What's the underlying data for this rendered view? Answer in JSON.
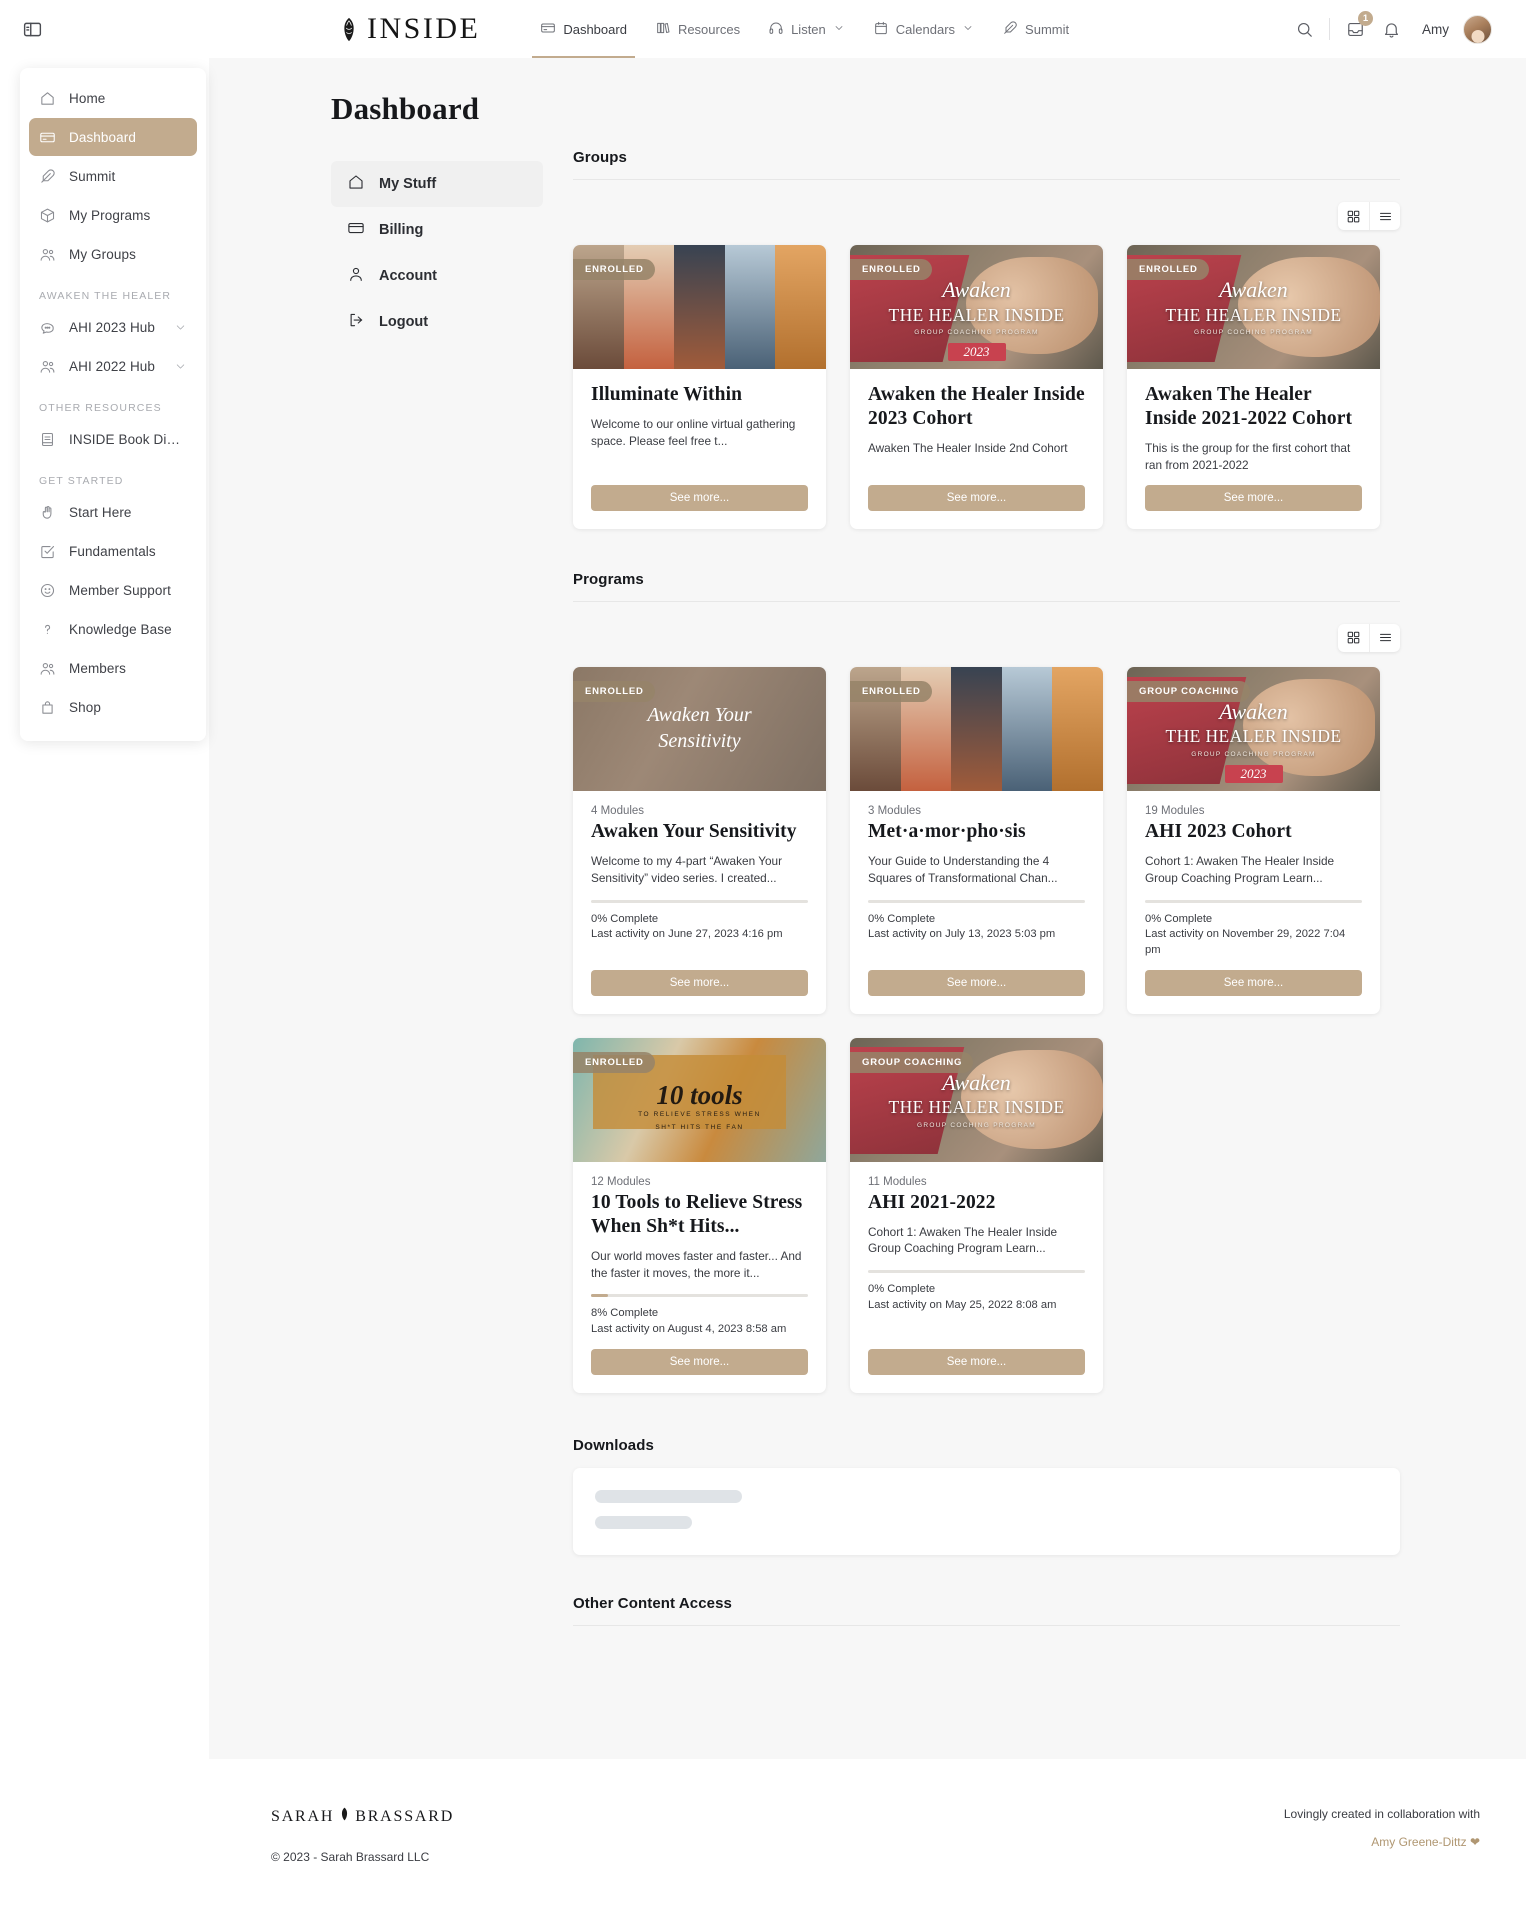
{
  "sidebar": {
    "toggle_icon": "panel-toggle-icon",
    "items": [
      {
        "label": "Home",
        "icon": "home-icon",
        "active": false
      },
      {
        "label": "Dashboard",
        "icon": "card-icon",
        "active": true
      },
      {
        "label": "Summit",
        "icon": "feather-icon",
        "active": false
      },
      {
        "label": "My Programs",
        "icon": "box-icon",
        "active": false
      },
      {
        "label": "My Groups",
        "icon": "users-icon",
        "active": false
      }
    ],
    "sections": [
      {
        "title": "AWAKEN THE HEALER",
        "items": [
          {
            "label": "AHI 2023 Hub",
            "icon": "chat-icon",
            "chevron": true
          },
          {
            "label": "AHI 2022 Hub",
            "icon": "users-icon",
            "chevron": true
          }
        ]
      },
      {
        "title": "OTHER RESOURCES",
        "items": [
          {
            "label": "INSIDE Book Digital ...",
            "icon": "book-icon",
            "chevron": false
          }
        ]
      },
      {
        "title": "GET STARTED",
        "items": [
          {
            "label": "Start Here",
            "icon": "wave-hand-icon",
            "chevron": false
          },
          {
            "label": "Fundamentals",
            "icon": "check-square-icon",
            "chevron": false
          },
          {
            "label": "Member Support",
            "icon": "smiley-icon",
            "chevron": false
          },
          {
            "label": "Knowledge Base",
            "icon": "question-icon",
            "chevron": false
          },
          {
            "label": "Members",
            "icon": "users-icon",
            "chevron": false
          },
          {
            "label": "Shop",
            "icon": "bag-icon",
            "chevron": false
          }
        ]
      }
    ]
  },
  "topbar": {
    "brand": "INSIDE",
    "brand_mark": "pinecone-icon",
    "nav": [
      {
        "label": "Dashboard",
        "icon": "card-icon",
        "chevron": false,
        "active": true
      },
      {
        "label": "Resources",
        "icon": "books-icon",
        "chevron": false,
        "active": false
      },
      {
        "label": "Listen",
        "icon": "headphones-icon",
        "chevron": true,
        "active": false
      },
      {
        "label": "Calendars",
        "icon": "calendar-icon",
        "chevron": true,
        "active": false
      },
      {
        "label": "Summit",
        "icon": "feather-icon",
        "chevron": false,
        "active": false
      }
    ],
    "search_icon": "search-icon",
    "inbox_icon": "inbox-icon",
    "inbox_count": "1",
    "bell_icon": "bell-icon",
    "user_name": "Amy",
    "avatar": "user-avatar"
  },
  "main": {
    "page_title": "Dashboard",
    "subnav": [
      {
        "label": "My Stuff",
        "icon": "home-icon",
        "active": true
      },
      {
        "label": "Billing",
        "icon": "card-icon",
        "active": false
      },
      {
        "label": "Account",
        "icon": "person-icon",
        "active": false
      },
      {
        "label": "Logout",
        "icon": "logout-icon",
        "active": false
      }
    ],
    "view_toggle": {
      "grid_icon": "grid-view-icon",
      "list_icon": "list-view-icon"
    },
    "sections": {
      "groups": {
        "heading": "Groups",
        "cards": [
          {
            "badge": "ENROLLED",
            "title": "Illuminate Within",
            "description": "Welcome to our online virtual gathering space. Please feel free t...",
            "button": "See more...",
            "thumb": "collage-thumb"
          },
          {
            "badge": "ENROLLED",
            "title": "Awaken the Healer Inside 2023 Cohort",
            "description": "Awaken The Healer Inside 2nd Cohort",
            "button": "See more...",
            "thumb": "ahi-2023-thumb"
          },
          {
            "badge": "ENROLLED",
            "title": "Awaken The Healer Inside 2021-2022 Cohort",
            "description": "This is the group for the first cohort that ran from 2021-2022",
            "button": "See more...",
            "thumb": "ahi-hands-thumb"
          }
        ]
      },
      "programs": {
        "heading": "Programs",
        "cards": [
          {
            "badge": "ENROLLED",
            "modules": "4 Modules",
            "title": "Awaken Your Sensitivity",
            "description": "Welcome to my 4-part “Awaken Your Sensitivity” video series. I created...",
            "progress": "0% Complete",
            "progress_value": 0,
            "last_activity": "Last activity on June 27, 2023 4:16 pm",
            "button": "See more...",
            "thumb": "awaken-sensitivity-thumb"
          },
          {
            "badge": "ENROLLED",
            "modules": "3 Modules",
            "title": "Met·a·mor·pho·sis",
            "description": "Your Guide to Understanding the 4 Squares of Transformational Chan...",
            "progress": "0% Complete",
            "progress_value": 0,
            "last_activity": "Last activity on July 13, 2023 5:03 pm",
            "button": "See more...",
            "thumb": "collage-thumb"
          },
          {
            "badge": "GROUP COACHING",
            "modules": "19 Modules",
            "title": "AHI 2023 Cohort",
            "description": "Cohort 1: Awaken The Healer Inside Group Coaching Program Learn...",
            "progress": "0% Complete",
            "progress_value": 0,
            "last_activity": "Last activity on November 29, 2022 7:04 pm",
            "button": "See more...",
            "thumb": "ahi-2023-thumb"
          },
          {
            "badge": "ENROLLED",
            "modules": "12 Modules",
            "title": "10 Tools to Relieve Stress When Sh*t Hits...",
            "description": "Our world moves faster and faster... And the faster it moves, the more it...",
            "progress": "8% Complete",
            "progress_value": 8,
            "last_activity": "Last activity on August 4, 2023 8:58 am",
            "button": "See more...",
            "thumb": "ten-tools-thumb"
          },
          {
            "badge": "GROUP COACHING",
            "modules": "11 Modules",
            "title": "AHI 2021-2022",
            "description": "Cohort 1: Awaken The Healer Inside Group Coaching Program Learn...",
            "progress": "0% Complete",
            "progress_value": 0,
            "last_activity": "Last activity on May 25, 2022 8:08 am",
            "button": "See more...",
            "thumb": "ahi-hands-thumb"
          }
        ]
      },
      "downloads": {
        "heading": "Downloads",
        "loading": true
      },
      "other_content": {
        "heading": "Other Content Access"
      }
    }
  },
  "footer": {
    "logo_left": "SARAH",
    "logo_right": "BRASSARD",
    "copyright": "© 2023 - Sarah Brassard LLC",
    "collab_note": "Lovingly created in collaboration with",
    "collab_name": "Amy Greene-Dittz ❤"
  },
  "colors": {
    "accent": "#c2ab8e",
    "badge": "#968369",
    "page_bg": "#f7f7f7",
    "text": "#16181c",
    "muted": "#6e7077",
    "credit": "#b09772"
  }
}
